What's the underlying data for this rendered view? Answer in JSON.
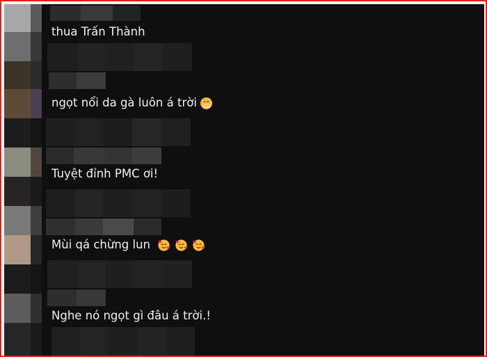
{
  "comments": [
    {
      "text": "thua Trấn Thành",
      "emojis": []
    },
    {
      "text": "ngọt nổi da gà luôn á trời",
      "emojis": [
        "face-with-hand-over-mouth-emoji"
      ]
    },
    {
      "text": "Tuyệt đỉnh PMC ơi!",
      "emojis": []
    },
    {
      "text": "Mùi qá chừng lun",
      "emojis": [
        "smiling-face-with-hearts-emoji",
        "smiling-face-with-hearts-emoji",
        "smiling-face-with-hearts-emoji"
      ]
    },
    {
      "text": "Nghe nó ngọt gì đâu á trời.!",
      "emojis": []
    }
  ],
  "colors": {
    "frame_border": "#e0211d",
    "background": "#0f0f0f",
    "comment_text": "#f1f1f1",
    "emoji_face": "#ffb938",
    "emoji_heart": "#e8245a"
  }
}
